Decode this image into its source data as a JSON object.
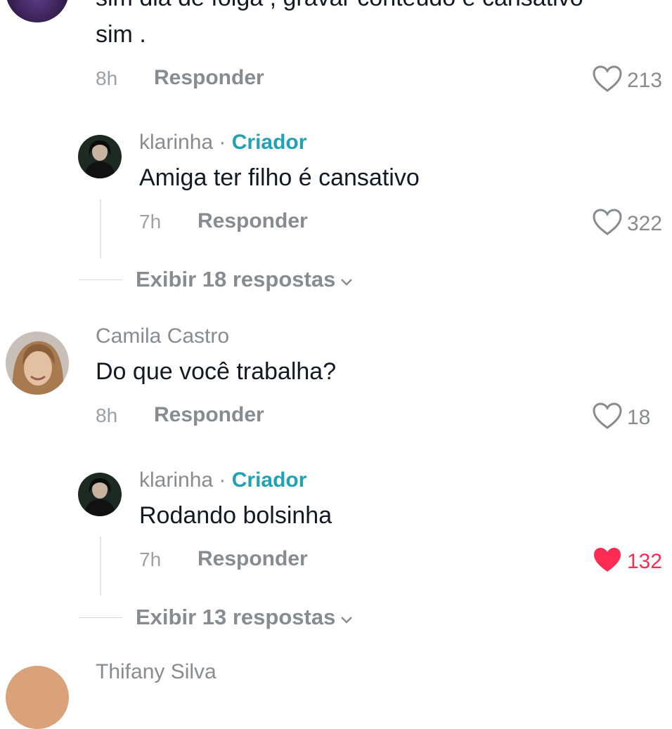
{
  "comments": [
    {
      "text_line1": "sim dia de folga , gravar conteúdo é cansativo",
      "text_line2": "sim .",
      "time": "8h",
      "reply_label": "Responder",
      "likes": "213",
      "liked": false,
      "reply": {
        "username": "klarinha",
        "separator": "·",
        "badge": "Criador",
        "text": "Amiga ter filho é cansativo",
        "time": "7h",
        "reply_label": "Responder",
        "likes": "322",
        "liked": false
      },
      "view_more": "Exibir 18 respostas"
    },
    {
      "username": "Camila Castro",
      "text": "Do que você trabalha?",
      "time": "8h",
      "reply_label": "Responder",
      "likes": "18",
      "liked": false,
      "reply": {
        "username": "klarinha",
        "separator": "·",
        "badge": "Criador",
        "text": "Rodando bolsinha",
        "time": "7h",
        "reply_label": "Responder",
        "likes": "132",
        "liked": true
      },
      "view_more": "Exibir 13 respostas"
    },
    {
      "username": "Thifany Silva"
    }
  ],
  "colors": {
    "creator_badge": "#20a2b5",
    "liked_heart": "#fe2c55",
    "muted_text": "#8a8b91"
  }
}
